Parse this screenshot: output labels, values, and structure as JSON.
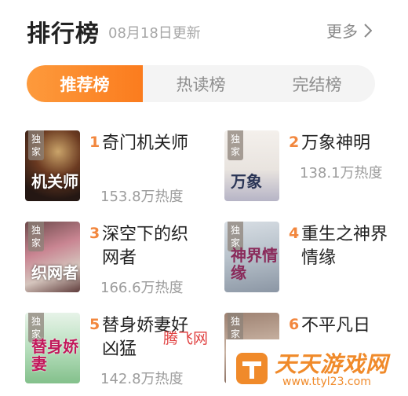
{
  "header": {
    "title": "排行榜",
    "updated": "08月18日更新",
    "more_label": "更多"
  },
  "tabs": [
    {
      "label": "推荐榜",
      "active": true
    },
    {
      "label": "热读榜",
      "active": false
    },
    {
      "label": "完结榜",
      "active": false
    }
  ],
  "books": [
    {
      "rank": "1",
      "title": "奇门机关师",
      "heat": "153.8万热度",
      "badge": "独家",
      "cover_text": "机关师"
    },
    {
      "rank": "2",
      "title": "万象神明",
      "heat": "138.1万热度",
      "badge": "独家",
      "cover_text": "万象"
    },
    {
      "rank": "3",
      "title": "深空下的织网者",
      "heat": "166.6万热度",
      "badge": "独家",
      "cover_text": "织网者"
    },
    {
      "rank": "4",
      "title": "重生之神界情缘",
      "heat": "",
      "badge": "独家",
      "cover_text": "神界情缘"
    },
    {
      "rank": "5",
      "title": "替身娇妻好凶猛",
      "heat": "142.8万热度",
      "badge": "独家",
      "cover_text": "替身娇妻"
    },
    {
      "rank": "6",
      "title": "不平凡日",
      "heat": "",
      "badge": "独家",
      "cover_text": ""
    }
  ],
  "watermarks": {
    "red": "腾飞网",
    "logo_text": "天天游戏网",
    "logo_url": "www.ttyl23.com"
  },
  "colors": {
    "accent": "#fb7c1e",
    "rank": "#f2873e",
    "muted": "#9c9c9c"
  }
}
